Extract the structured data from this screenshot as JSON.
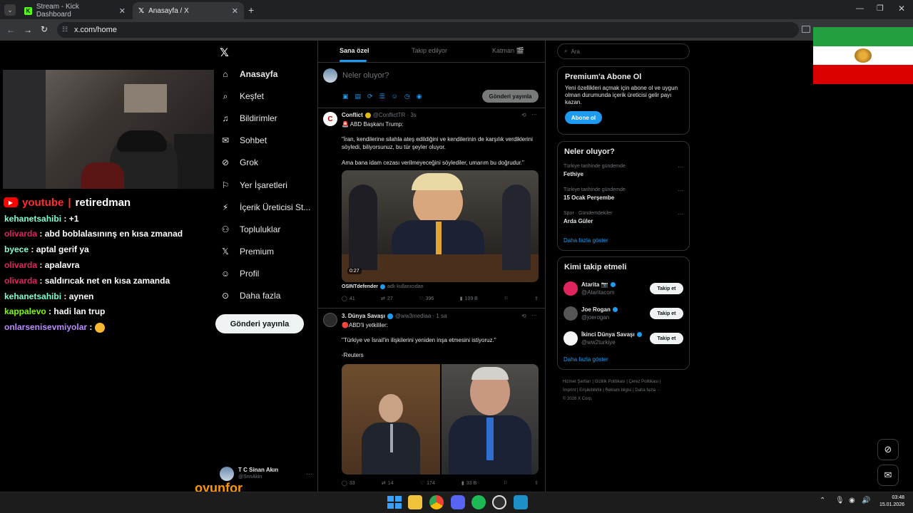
{
  "browser": {
    "tabs": [
      {
        "title": "Stream - Kick Dashboard"
      },
      {
        "title": "Anasayfa / X"
      }
    ],
    "url": "x.com/home"
  },
  "stream": {
    "channel": {
      "platform": "youtube",
      "name": "retiredman"
    },
    "chat": [
      {
        "user": "kehanetsahibi",
        "msg": ": +1",
        "color": "#7fffd4"
      },
      {
        "user": "olivarda",
        "msg": ": abd boblalasınınş en kısa zmanad",
        "color": "#e0245e"
      },
      {
        "user": "byece",
        "msg": ": aptal gerif ya",
        "color": "#7fffd4"
      },
      {
        "user": "olivarda",
        "msg": ": apalavra",
        "color": "#e0245e"
      },
      {
        "user": "olivarda",
        "msg": ": saldırıcak net en kısa zamanda",
        "color": "#e0245e"
      },
      {
        "user": "kehanetsahibi",
        "msg": ": aynen",
        "color": "#7fffd4"
      },
      {
        "user": "kappalevo",
        "msg": ": hadi lan trup",
        "color": "#7cfc00"
      },
      {
        "user": "onlarsenisevmiyolar",
        "msg": ":",
        "color": "#ba8cff"
      }
    ],
    "watermark": "oyunfor"
  },
  "nav": {
    "items": [
      {
        "label": "Anasayfa",
        "icon": "home-icon"
      },
      {
        "label": "Keşfet",
        "icon": "search-icon"
      },
      {
        "label": "Bildirimler",
        "icon": "bell-icon"
      },
      {
        "label": "Sohbet",
        "icon": "mail-icon"
      },
      {
        "label": "Grok",
        "icon": "grok-icon"
      },
      {
        "label": "Yer İşaretleri",
        "icon": "bookmark-icon"
      },
      {
        "label": "İçerik Üreticisi St...",
        "icon": "lightning-icon"
      },
      {
        "label": "Topluluklar",
        "icon": "people-icon"
      },
      {
        "label": "Premium",
        "icon": "x-logo-icon"
      },
      {
        "label": "Profil",
        "icon": "person-icon"
      },
      {
        "label": "Daha fazla",
        "icon": "more-circle-icon"
      }
    ],
    "post_button": "Gönderi yayınla",
    "account": {
      "name": "T C Sinan Akın",
      "handle": "@SnnAkin"
    }
  },
  "feed": {
    "tabs": [
      "Sana özel",
      "Takip edilyor",
      "Katman 🎬"
    ],
    "composer": {
      "placeholder": "Neler oluyor?",
      "button": "Gönderi yayınla"
    },
    "tweets": [
      {
        "name": "Conflict",
        "handle": "@ConflictTR · 3s",
        "text1": "🚨 ABD Başkanı Trump:",
        "text2": "\"İran, kendilerine silahla ateş edildiğini ve kendilerinin de karşılık verdiklerini söyledi, biliyorsunuz, bu tür şeyler oluyor.",
        "text3": "Ama bana idam cezası verilmeyeceğini söylediler, umarım bu doğrudur.\"",
        "video_time": "0:27",
        "via_name": "OSINTdefender",
        "via_label": "adlı kullanıcıdan",
        "stats": {
          "replies": "41",
          "reposts": "27",
          "likes": "396",
          "views": "109 B"
        }
      },
      {
        "name": "3. Dünya Savaşı",
        "handle": "@ww3mediaa · 1 sa",
        "text1": "🔴ABD'li yetkililer:",
        "text2": "\"Türkiye ve İsrail'in ilişkilerini yeniden inşa etmesini istiyoruz.\"",
        "text3": "-Reuters",
        "stats": {
          "replies": "33",
          "reposts": "14",
          "likes": "174",
          "views": "33 B"
        }
      }
    ]
  },
  "sidebar": {
    "search_placeholder": "Ara",
    "premium": {
      "title": "Premium'a Abone Ol",
      "text": "Yeni özellikleri açmak için abone ol ve uygun olman durumunda içerik üreticisi gelir payı kazan.",
      "button": "Abone ol"
    },
    "trends": {
      "title": "Neler oluyor?",
      "items": [
        {
          "context": "Türkiye tarihinde gündemde",
          "name": "Fethiye"
        },
        {
          "context": "Türkiye tarihinde gündemde",
          "name": "15 Ocak Perşembe"
        },
        {
          "context": "Spor · Gündemdekiler",
          "name": "Arda Güler"
        }
      ],
      "more": "Daha fazla göster"
    },
    "follow": {
      "title": "Kimi takip etmeli",
      "items": [
        {
          "name": "Atarita 📷",
          "handle": "@Ataritacom",
          "button": "Takip et"
        },
        {
          "name": "Joe Rogan",
          "handle": "@joerogan",
          "button": "Takip et"
        },
        {
          "name": "İkinci Dünya Savaşı",
          "handle": "@ww2turkiye",
          "button": "Takip et"
        }
      ],
      "more": "Daha fazla göster"
    },
    "footer": {
      "line1": "Hizmet Şartları | Gizlilik Politikası | Çerez Politikası |",
      "line2": "İmprint | Erişilebilirlik | Reklam bilgisi | Daha fazla ···",
      "line3": "© 2026 X Corp."
    }
  },
  "taskbar": {
    "time": "03:48",
    "date": "15.01.2026"
  }
}
